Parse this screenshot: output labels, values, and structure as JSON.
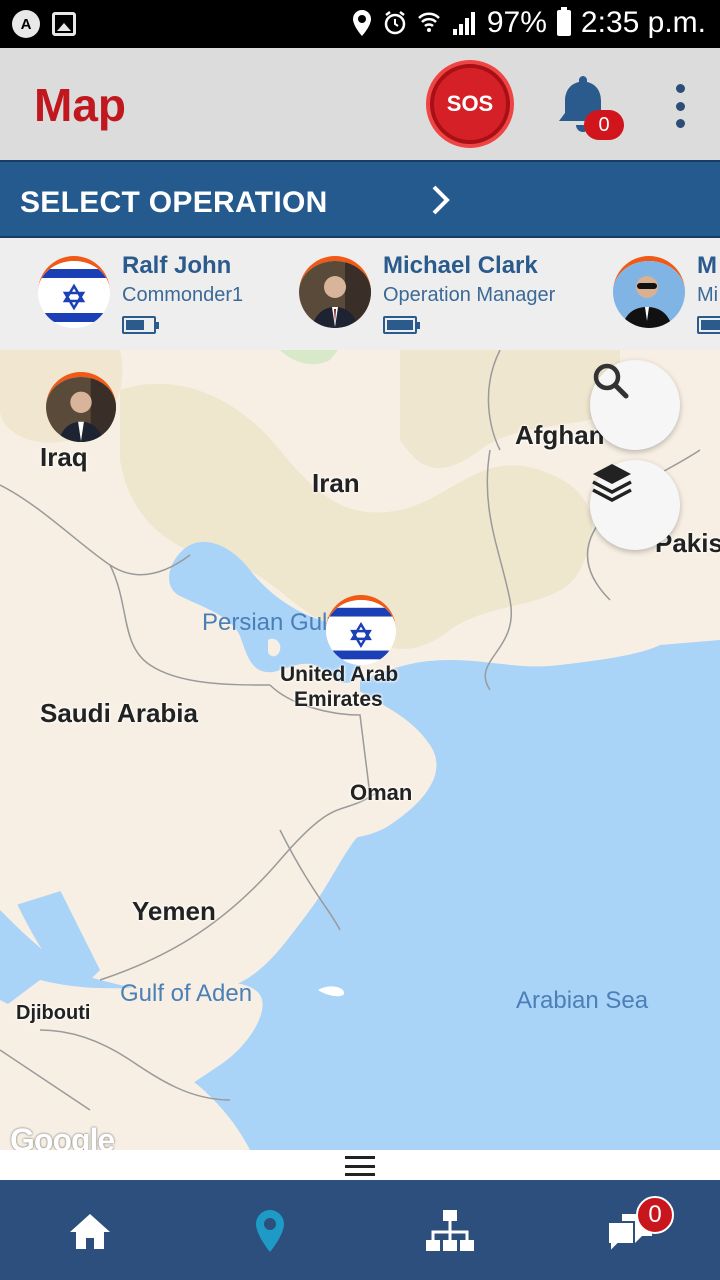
{
  "status_bar": {
    "battery": "97%",
    "time": "2:35 p.m.",
    "left_icon_letter": "A"
  },
  "app_bar": {
    "title": "Map",
    "sos_label": "SOS",
    "notifications_count": "0"
  },
  "operation_bar": {
    "label": "SELECT OPERATION"
  },
  "members": [
    {
      "name": "Ralf John",
      "role": "Commonder1",
      "avatar": "israel-flag",
      "battery_level": 0.6
    },
    {
      "name": "Michael Clark",
      "role": "Operation Manager",
      "avatar": "photo-man-suit",
      "battery_level": 1.0
    },
    {
      "name": "M",
      "role": "Mi",
      "avatar": "photo-man-sunglasses",
      "battery_level": 1.0
    }
  ],
  "map": {
    "country_labels": [
      "Iraq",
      "Iran",
      "Afghan",
      "Pakist",
      "Saudi Arabia",
      "United Arab",
      "Emirates",
      "Oman",
      "Yemen",
      "Djibouti"
    ],
    "sea_labels": [
      "Persian Gulf",
      "Gulf of Aden",
      "Arabian Sea"
    ],
    "attribution": "Google",
    "colors": {
      "land": "#f7efe3",
      "water": "#aad3f8",
      "border": "#8f8f8f"
    }
  },
  "bottom_nav": {
    "chat_badge": "0",
    "items": [
      "home-icon",
      "location-pin-icon",
      "hierarchy-icon",
      "chat-icon"
    ],
    "active_color": "#1d9bc6"
  },
  "colors": {
    "brand_red": "#c0181e",
    "primary_blue": "#255a8e",
    "nav_blue": "#2c4f7d"
  }
}
